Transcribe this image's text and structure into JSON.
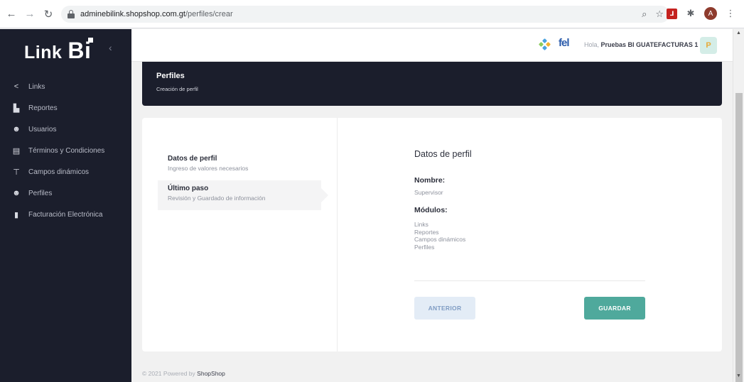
{
  "browser": {
    "url_host": "adminebilink.shopshop.com.gt",
    "url_path": "/perfiles/crear",
    "profile_initial": "A"
  },
  "sidebar": {
    "logo_text": "Link",
    "logo_bi": "Bi",
    "items": [
      {
        "label": "Links",
        "icon": "share-icon"
      },
      {
        "label": "Reportes",
        "icon": "chart-icon"
      },
      {
        "label": "Usuarios",
        "icon": "users-icon"
      },
      {
        "label": "Términos y Condiciones",
        "icon": "document-icon"
      },
      {
        "label": "Campos dinámicos",
        "icon": "fields-icon"
      },
      {
        "label": "Perfiles",
        "icon": "profiles-icon"
      },
      {
        "label": "Facturación Electrónica",
        "icon": "invoice-icon"
      }
    ]
  },
  "header": {
    "greeting_prefix": "Hola,",
    "user_name": "Pruebas BI GUATEFACTURAS 1",
    "avatar_initial": "P",
    "fel_logo": "fel"
  },
  "page": {
    "title": "Perfiles",
    "subtitle": "Creación de perfil"
  },
  "steps": [
    {
      "title": "Datos de perfil",
      "desc": "Ingreso de valores necesarios"
    },
    {
      "title": "Último paso",
      "desc": "Revisión y Guardado de información"
    }
  ],
  "detail": {
    "title": "Datos de perfil",
    "nombre_label": "Nombre:",
    "nombre_value": "Supervisor",
    "modulos_label": "Módulos:",
    "modulos": [
      "Links",
      "Reportes",
      "Campos dinámicos",
      "Perfiles"
    ]
  },
  "buttons": {
    "prev_label": "ANTERIOR",
    "save_label": "GUARDAR"
  },
  "footer": {
    "prefix": "© 2021 Powered by",
    "brand": "ShopShop"
  },
  "colors": {
    "sidebar_bg": "#1b1e2c",
    "accent_green": "#4fa99c",
    "prev_btn": "#e3ecf6"
  }
}
